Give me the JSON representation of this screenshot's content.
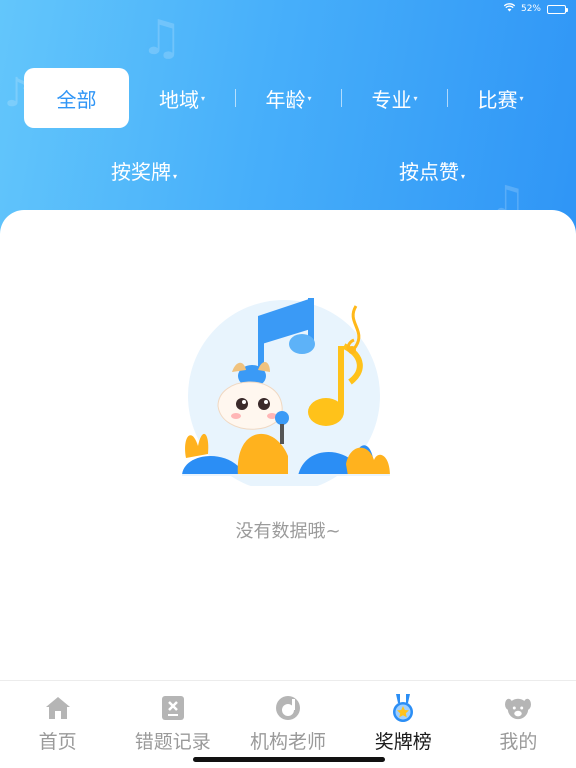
{
  "status_bar": {
    "battery_percent": "52%",
    "battery_level": 0.52
  },
  "filters": {
    "primary": [
      {
        "label": "全部",
        "active": true
      },
      {
        "label": "地域",
        "active": false
      },
      {
        "label": "年龄",
        "active": false
      },
      {
        "label": "专业",
        "active": false
      },
      {
        "label": "比赛",
        "active": false
      }
    ],
    "sort": [
      {
        "label": "按奖牌"
      },
      {
        "label": "按点赞"
      }
    ]
  },
  "empty_state": {
    "message": "没有数据哦~"
  },
  "tab_bar": {
    "items": [
      {
        "label": "首页",
        "icon": "home-icon",
        "active": false
      },
      {
        "label": "错题记录",
        "icon": "wrong-record-icon",
        "active": false
      },
      {
        "label": "机构老师",
        "icon": "teacher-icon",
        "active": false
      },
      {
        "label": "奖牌榜",
        "icon": "medal-icon",
        "active": true
      },
      {
        "label": "我的",
        "icon": "profile-icon",
        "active": false
      }
    ]
  },
  "colors": {
    "accent": "#2f95f6",
    "header_gradient_start": "#63c6fb",
    "header_gradient_end": "#2f95f6",
    "tab_inactive": "#9a9a9a",
    "tab_active": "#1b1b1b",
    "empty_text": "#9b9b9b"
  }
}
